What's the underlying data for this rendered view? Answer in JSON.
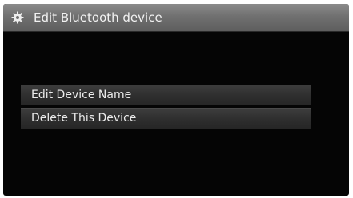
{
  "header": {
    "icon": "gear-icon",
    "title": "Edit Bluetooth device"
  },
  "menu": {
    "items": [
      {
        "label": "Edit Device Name"
      },
      {
        "label": "Delete This Device"
      }
    ]
  }
}
